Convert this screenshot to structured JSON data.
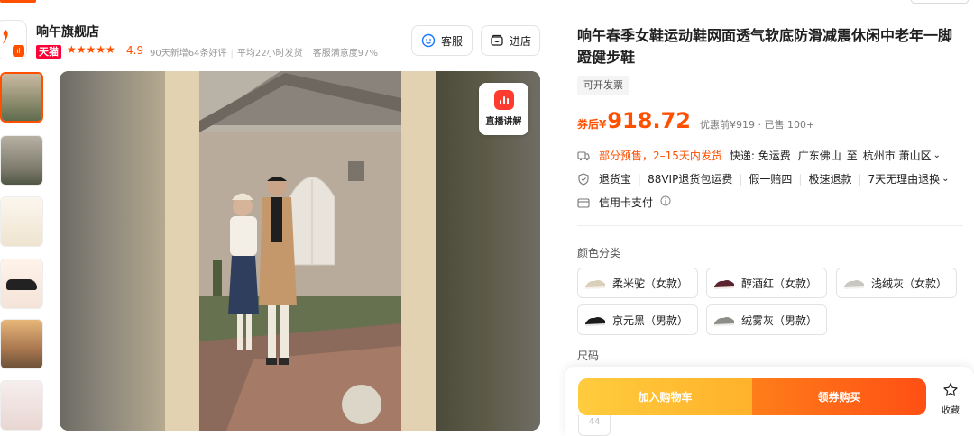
{
  "store": {
    "name": "响午旗舰店",
    "platform_tag": "天猫",
    "stars": "★★★★★",
    "rating": "4.9",
    "meta": [
      "90天新增64条好评",
      "平均22小时发货",
      "客服满意度97%"
    ],
    "buttons": {
      "service": "客服",
      "enter": "进店"
    }
  },
  "gallery": {
    "thumbnail_count": 7,
    "active_index": 0,
    "live_badge": "直播讲解"
  },
  "product": {
    "title": "响午春季女鞋运动鞋网面透气软底防滑减震休闲中老年一脚蹬健步鞋",
    "invoice_tag": "可开发票",
    "price_prefix": "券后¥",
    "price": "918.72",
    "price_note": "优惠前¥919 · 已售 100+"
  },
  "delivery": {
    "presale": "部分预售，2–15天内发货",
    "shipping": "快递: 免运费",
    "from": "广东佛山",
    "to_label": "至",
    "destination": "杭州市 萧山区"
  },
  "services": [
    "退货宝",
    "88VIP退货包运费",
    "假一赔四",
    "极速退款",
    "7天无理由退换"
  ],
  "payment": {
    "label": "信用卡支付"
  },
  "colors": {
    "label": "颜色分类",
    "options": [
      "柔米驼（女款）",
      "醇酒红（女款）",
      "浅绒灰（女款）",
      "京元黑（男款）",
      "绒雾灰（男款）"
    ]
  },
  "size": {
    "label": "尺码",
    "peek": "44"
  },
  "actions": {
    "add_to_cart": "加入购物车",
    "buy_now": "领券购买",
    "favorite": "收藏"
  },
  "theme": {
    "accent": "#ff5000",
    "tmall_red": "#ff0036",
    "cart_yellow": "#ffb12a"
  }
}
